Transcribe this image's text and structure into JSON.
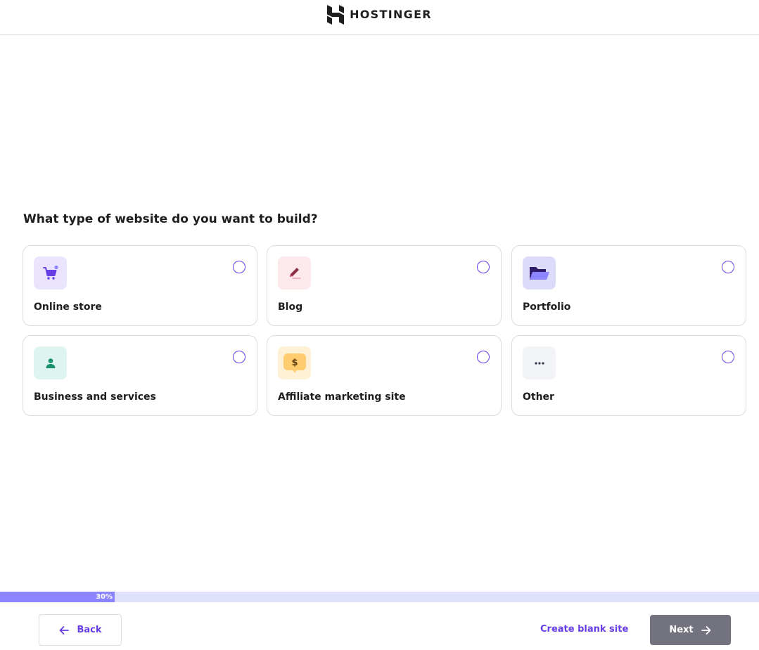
{
  "header": {
    "brand": "HOSTINGER",
    "logo_icon": "hostinger-logo-icon"
  },
  "question": "What type of website do you want to build?",
  "options": [
    {
      "label": "Online store",
      "icon": "cart-icon",
      "icon_bg": "#ebe4ff",
      "selected": false
    },
    {
      "label": "Blog",
      "icon": "pen-icon",
      "icon_bg": "#fde8ec",
      "selected": false
    },
    {
      "label": "Portfolio",
      "icon": "folder-icon",
      "icon_bg": "#dcdcfa",
      "selected": false
    },
    {
      "label": "Business and services",
      "icon": "person-icon",
      "icon_bg": "#def4f0",
      "selected": false
    },
    {
      "label": "Affiliate marketing site",
      "icon": "dollar-bubble-icon",
      "icon_bg": "#fff1d6",
      "selected": false
    },
    {
      "label": "Other",
      "icon": "more-dots-icon",
      "icon_bg": "#f2f3f6",
      "selected": false
    }
  ],
  "progress": {
    "value": 0.3,
    "label": "30%"
  },
  "footer": {
    "back_label": "Back",
    "create_blank_label": "Create blank site",
    "next_label": "Next"
  },
  "colors": {
    "accent": "#673de6",
    "progress_fill": "#8c85ff",
    "progress_track": "#dfe0fb",
    "next_disabled": "#737380"
  }
}
